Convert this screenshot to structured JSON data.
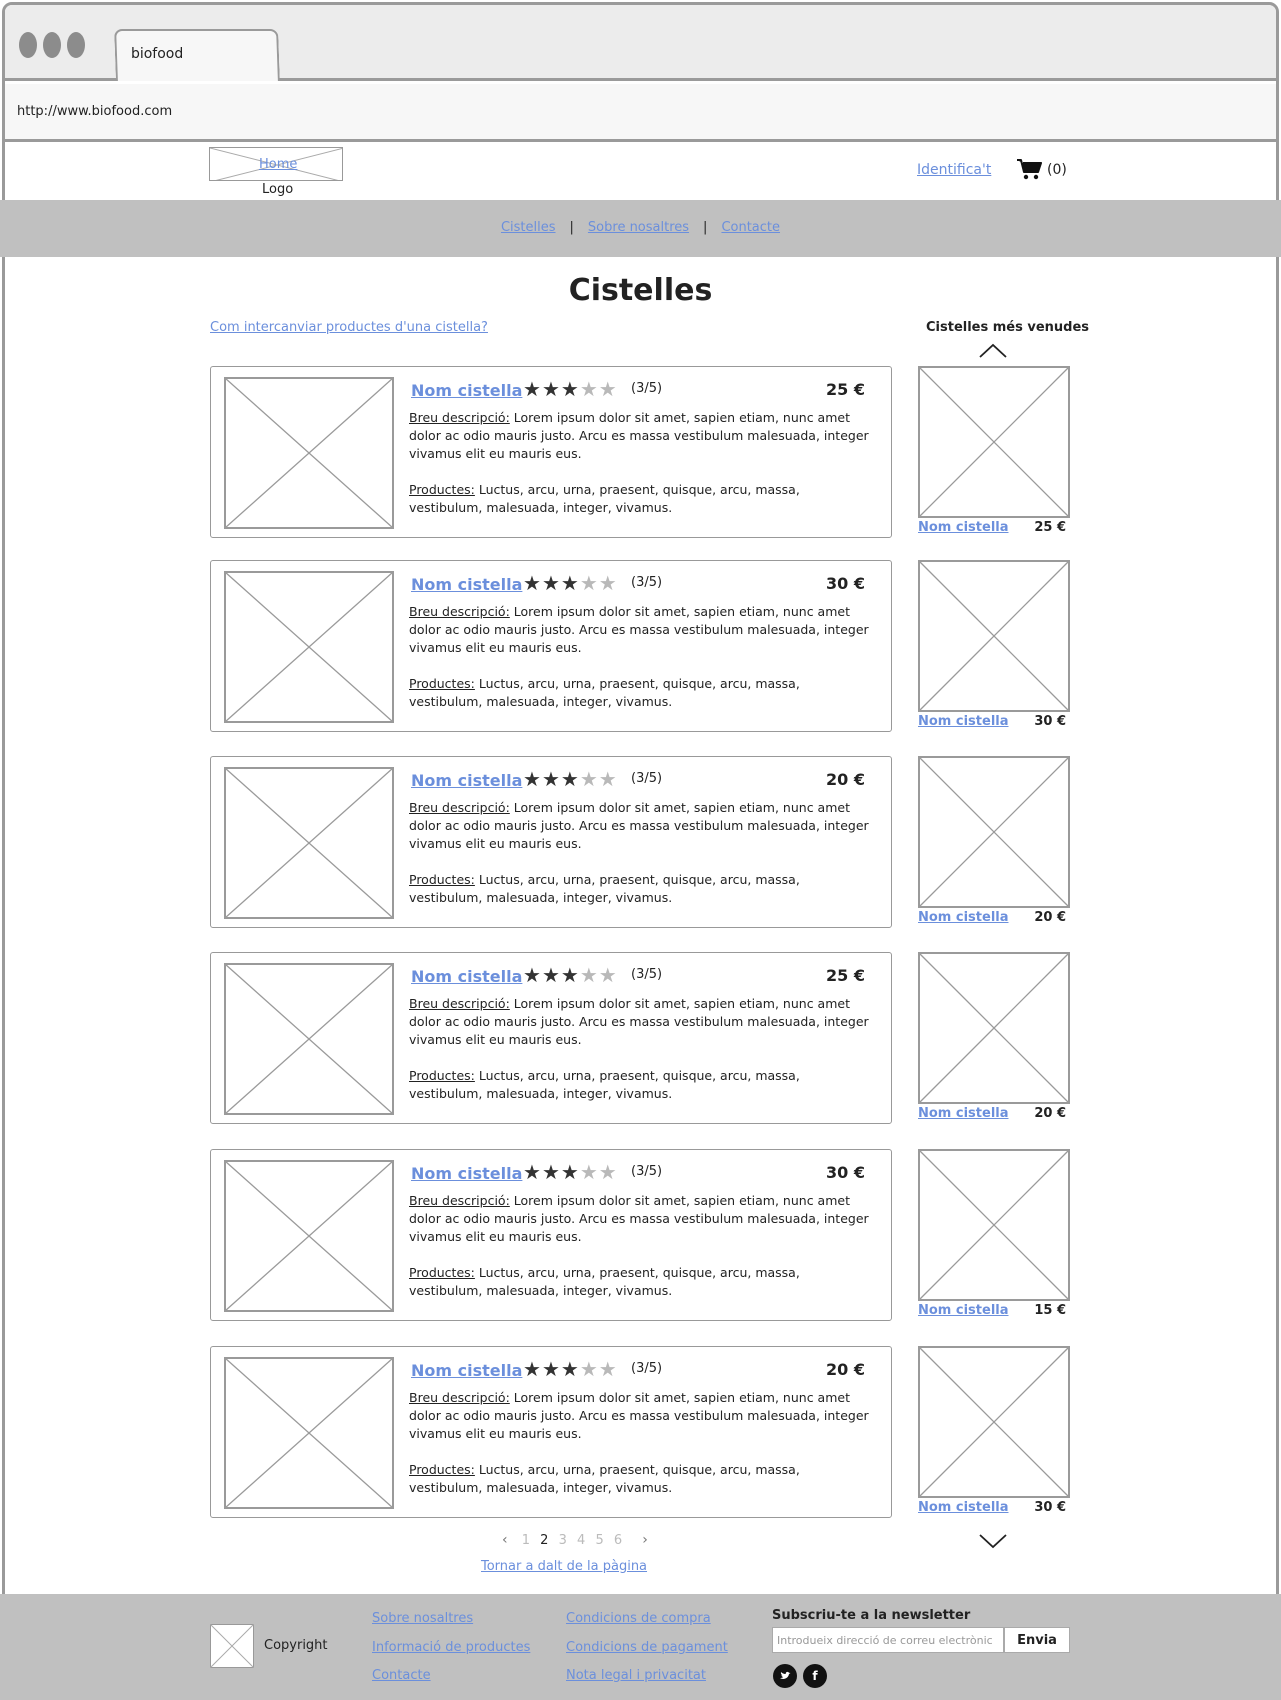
{
  "browser": {
    "tab_title": "biofood",
    "url": "http://www.biofood.com"
  },
  "header": {
    "home_label": "Home",
    "logo_label": "Logo",
    "login_label": "Identifica't",
    "cart_count": "(0)",
    "cart_icon": "shopping-cart-icon"
  },
  "nav": {
    "items": [
      {
        "label": "Cistelles"
      },
      {
        "label": "Sobre nosaltres"
      },
      {
        "label": "Contacte"
      }
    ],
    "separator": "|"
  },
  "main": {
    "title": "Cistelles",
    "help_link": "Com intercanviar productes d'una cistella?",
    "products": [
      {
        "name": "Nom cistella",
        "rating": 3,
        "rating_text": "(3/5)",
        "price": "25 €",
        "desc_label": "Breu descripció:",
        "desc": " Lorem ipsum dolor sit amet, sapien etiam, nunc amet dolor ac odio mauris justo. Arcu es massa vestibulum malesuada, integer vivamus elit eu mauris eus.",
        "prod_label": "Productes:",
        "prods": " Luctus, arcu, urna, praesent, quisque, arcu, massa, vestibulum, malesuada, integer, vivamus."
      },
      {
        "name": "Nom cistella",
        "rating": 3,
        "rating_text": "(3/5)",
        "price": "30 €",
        "desc_label": "Breu descripció:",
        "desc": " Lorem ipsum dolor sit amet, sapien etiam, nunc amet dolor ac odio mauris justo. Arcu es massa vestibulum malesuada, integer vivamus elit eu mauris eus.",
        "prod_label": "Productes:",
        "prods": " Luctus, arcu, urna, praesent, quisque, arcu, massa, vestibulum, malesuada, integer, vivamus."
      },
      {
        "name": "Nom cistella",
        "rating": 3,
        "rating_text": "(3/5)",
        "price": "20 €",
        "desc_label": "Breu descripció:",
        "desc": " Lorem ipsum dolor sit amet, sapien etiam, nunc amet dolor ac odio mauris justo. Arcu es massa vestibulum malesuada, integer vivamus elit eu mauris eus.",
        "prod_label": "Productes:",
        "prods": " Luctus, arcu, urna, praesent, quisque, arcu, massa, vestibulum, malesuada, integer, vivamus."
      },
      {
        "name": "Nom cistella",
        "rating": 3,
        "rating_text": "(3/5)",
        "price": "25 €",
        "desc_label": "Breu descripció:",
        "desc": " Lorem ipsum dolor sit amet, sapien etiam, nunc amet dolor ac odio mauris justo. Arcu es massa vestibulum malesuada, integer vivamus elit eu mauris eus.",
        "prod_label": "Productes:",
        "prods": " Luctus, arcu, urna, praesent, quisque, arcu, massa, vestibulum, malesuada, integer, vivamus."
      },
      {
        "name": "Nom cistella",
        "rating": 3,
        "rating_text": "(3/5)",
        "price": "30 €",
        "desc_label": "Breu descripció:",
        "desc": " Lorem ipsum dolor sit amet, sapien etiam, nunc amet dolor ac odio mauris justo. Arcu es massa vestibulum malesuada, integer vivamus elit eu mauris eus.",
        "prod_label": "Productes:",
        "prods": " Luctus, arcu, urna, praesent, quisque, arcu, massa, vestibulum, malesuada, integer, vivamus."
      },
      {
        "name": "Nom cistella",
        "rating": 3,
        "rating_text": "(3/5)",
        "price": "20 €",
        "desc_label": "Breu descripció:",
        "desc": " Lorem ipsum dolor sit amet, sapien etiam, nunc amet dolor ac odio mauris justo. Arcu es massa vestibulum malesuada, integer vivamus elit eu mauris eus.",
        "prod_label": "Productes:",
        "prods": " Luctus, arcu, urna, praesent, quisque, arcu, massa, vestibulum, malesuada, integer, vivamus."
      }
    ]
  },
  "sidebar": {
    "title": "Cistelles més venudes",
    "items": [
      {
        "name": "Nom cistella",
        "price": "25 €"
      },
      {
        "name": "Nom cistella",
        "price": "30 €"
      },
      {
        "name": "Nom cistella",
        "price": "20 €"
      },
      {
        "name": "Nom cistella",
        "price": "20 €"
      },
      {
        "name": "Nom cistella",
        "price": "15 €"
      },
      {
        "name": "Nom cistella",
        "price": "30 €"
      }
    ]
  },
  "pagination": {
    "pages": [
      "1",
      "2",
      "3",
      "4",
      "5",
      "6"
    ],
    "current": "2",
    "prev_icon": "chevron-left-icon",
    "next_icon": "chevron-right-icon"
  },
  "back_to_top": "Tornar a dalt de la pàgina",
  "footer": {
    "copyright": "Copyright",
    "links_col1": [
      "Sobre nosaltres",
      "Informació de productes",
      "Contacte"
    ],
    "links_col2": [
      "Condicions de compra",
      "Condicions de pagament",
      "Nota legal i privacitat"
    ],
    "newsletter_title": "Subscriu-te a la newsletter",
    "newsletter_placeholder": "Introdueix direcció de correu electrònic",
    "newsletter_button": "Envia",
    "social": [
      "twitter-icon",
      "facebook-icon"
    ]
  }
}
